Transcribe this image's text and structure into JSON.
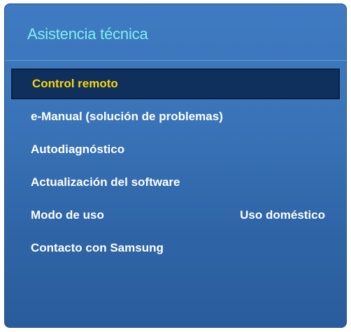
{
  "panel": {
    "title": "Asistencia técnica"
  },
  "menu": {
    "items": [
      {
        "label": "Control remoto",
        "value": ""
      },
      {
        "label": "e-Manual (solución de problemas)",
        "value": ""
      },
      {
        "label": "Autodiagnóstico",
        "value": ""
      },
      {
        "label": "Actualización del software",
        "value": ""
      },
      {
        "label": "Modo de uso",
        "value": "Uso doméstico"
      },
      {
        "label": "Contacto con Samsung",
        "value": ""
      }
    ],
    "selected_index": 0
  },
  "colors": {
    "title": "#7ef0ee",
    "selected_text": "#ffd600",
    "selected_bg": "#0f2f5c",
    "panel_bg": "#3a74b8",
    "text": "#ffffff"
  }
}
